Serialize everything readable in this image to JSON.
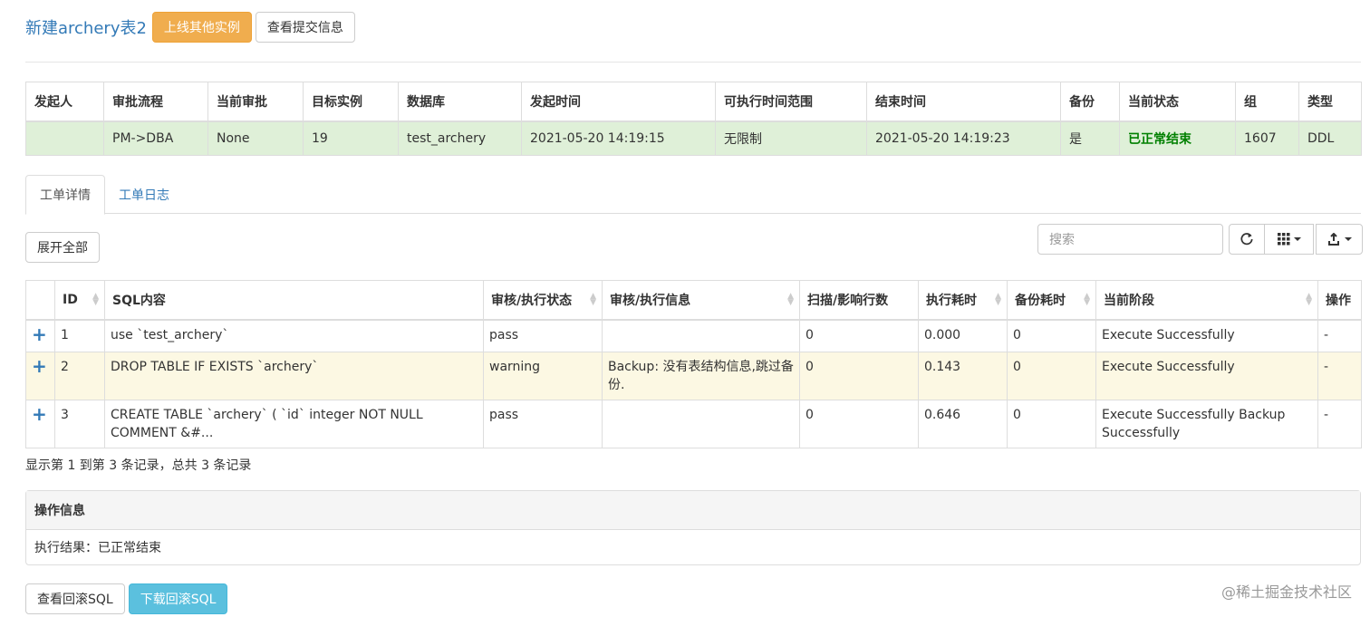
{
  "header": {
    "title": "新建archery表2",
    "online_other_label": "上线其他实例",
    "view_submit_label": "查看提交信息"
  },
  "info_table": {
    "headers": [
      "发起人",
      "审批流程",
      "当前审批",
      "目标实例",
      "数据库",
      "发起时间",
      "可执行时间范围",
      "结束时间",
      "备份",
      "当前状态",
      "组",
      "类型"
    ],
    "row": [
      "",
      "PM->DBA",
      "None",
      "19",
      "test_archery",
      "2021-05-20 14:19:15",
      "无限制",
      "2021-05-20 14:19:23",
      "是",
      "已正常结束",
      "1607",
      "DDL"
    ]
  },
  "tabs": [
    {
      "label": "工单详情",
      "active": true
    },
    {
      "label": "工单日志",
      "active": false
    }
  ],
  "toolbar": {
    "expand_all_label": "展开全部",
    "search_placeholder": "搜索",
    "refresh_icon": "refresh-icon",
    "columns_icon": "columns-icon",
    "export_icon": "export-icon"
  },
  "sql_table": {
    "headers": [
      "",
      "ID",
      "SQL内容",
      "审核/执行状态",
      "审核/执行信息",
      "扫描/影响行数",
      "执行耗时",
      "备份耗时",
      "当前阶段",
      "操作"
    ],
    "rows": [
      {
        "id": "1",
        "sql": "use `test_archery`",
        "status": "pass",
        "info": "",
        "rows": "0",
        "exec_time": "0.000",
        "backup_time": "0",
        "stage": "Execute Successfully",
        "action": "-"
      },
      {
        "id": "2",
        "sql": "DROP TABLE IF EXISTS `archery`",
        "status": "warning",
        "info": "Backup: 没有表结构信息,跳过备份.",
        "rows": "0",
        "exec_time": "0.143",
        "backup_time": "0",
        "stage": "Execute Successfully",
        "action": "-"
      },
      {
        "id": "3",
        "sql": "CREATE TABLE `archery` ( `id` integer NOT NULL COMMENT &#...",
        "status": "pass",
        "info": "",
        "rows": "0",
        "exec_time": "0.646",
        "backup_time": "0",
        "stage": "Execute Successfully Backup Successfully",
        "action": "-"
      }
    ]
  },
  "pager": "显示第 1 到第 3 条记录，总共 3 条记录",
  "panel": {
    "title": "操作信息",
    "body": "执行结果：已正常结束"
  },
  "bottom": {
    "view_rollback_label": "查看回滚SQL",
    "download_rollback_label": "下载回滚SQL"
  },
  "watermark": "@稀土掘金技术社区",
  "colors": {
    "success_row": "#dff0d8",
    "warning_row": "#fcf8e3",
    "status_green": "#008000",
    "link_blue": "#337ab7"
  }
}
